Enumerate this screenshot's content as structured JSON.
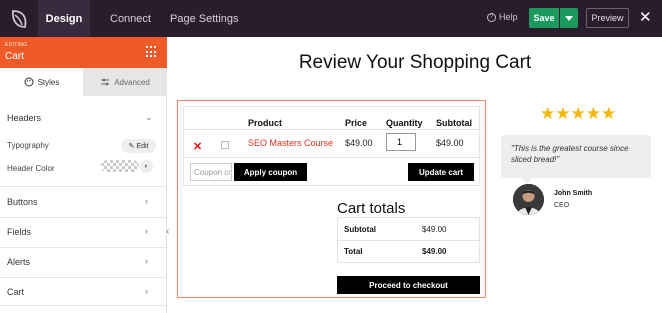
{
  "topbar": {
    "tabs": [
      "Design",
      "Connect",
      "Page Settings"
    ],
    "help": "Help",
    "save": "Save",
    "preview": "Preview",
    "colors": {
      "bg": "#2a1b2d",
      "save": "#1a9a5c"
    }
  },
  "sidebar": {
    "editing_label": "EDITING",
    "editing_name": "Cart",
    "tab_styles": "Styles",
    "tab_advanced": "Advanced",
    "sections": {
      "headers": "Headers",
      "typography": "Typography",
      "edit": "Edit",
      "header_color": "Header Color",
      "buttons": "Buttons",
      "fields": "Fields",
      "alerts": "Alerts",
      "cart": "Cart"
    },
    "accent": "#f05a28"
  },
  "page": {
    "title": "Review Your Shopping Cart",
    "cart": {
      "headers": {
        "product": "Product",
        "price": "Price",
        "quantity": "Quantity",
        "subtotal": "Subtotal"
      },
      "item": {
        "name": "SEO Masters Course",
        "price": "$49.00",
        "quantity": "1",
        "subtotal": "$49.00"
      },
      "coupon_placeholder": "Coupon code",
      "apply_coupon": "Apply coupon",
      "update_cart": "Update cart"
    },
    "totals": {
      "title": "Cart totals",
      "subtotal_label": "Subtotal",
      "subtotal_value": "$49.00",
      "total_label": "Total",
      "total_value": "$49.00",
      "checkout": "Proceed to checkout"
    },
    "testimonial": {
      "stars": "★★★★★",
      "quote": "\"This is the greatest course since sliced bread!\"",
      "author": "John Smith",
      "role": "CEO"
    }
  }
}
